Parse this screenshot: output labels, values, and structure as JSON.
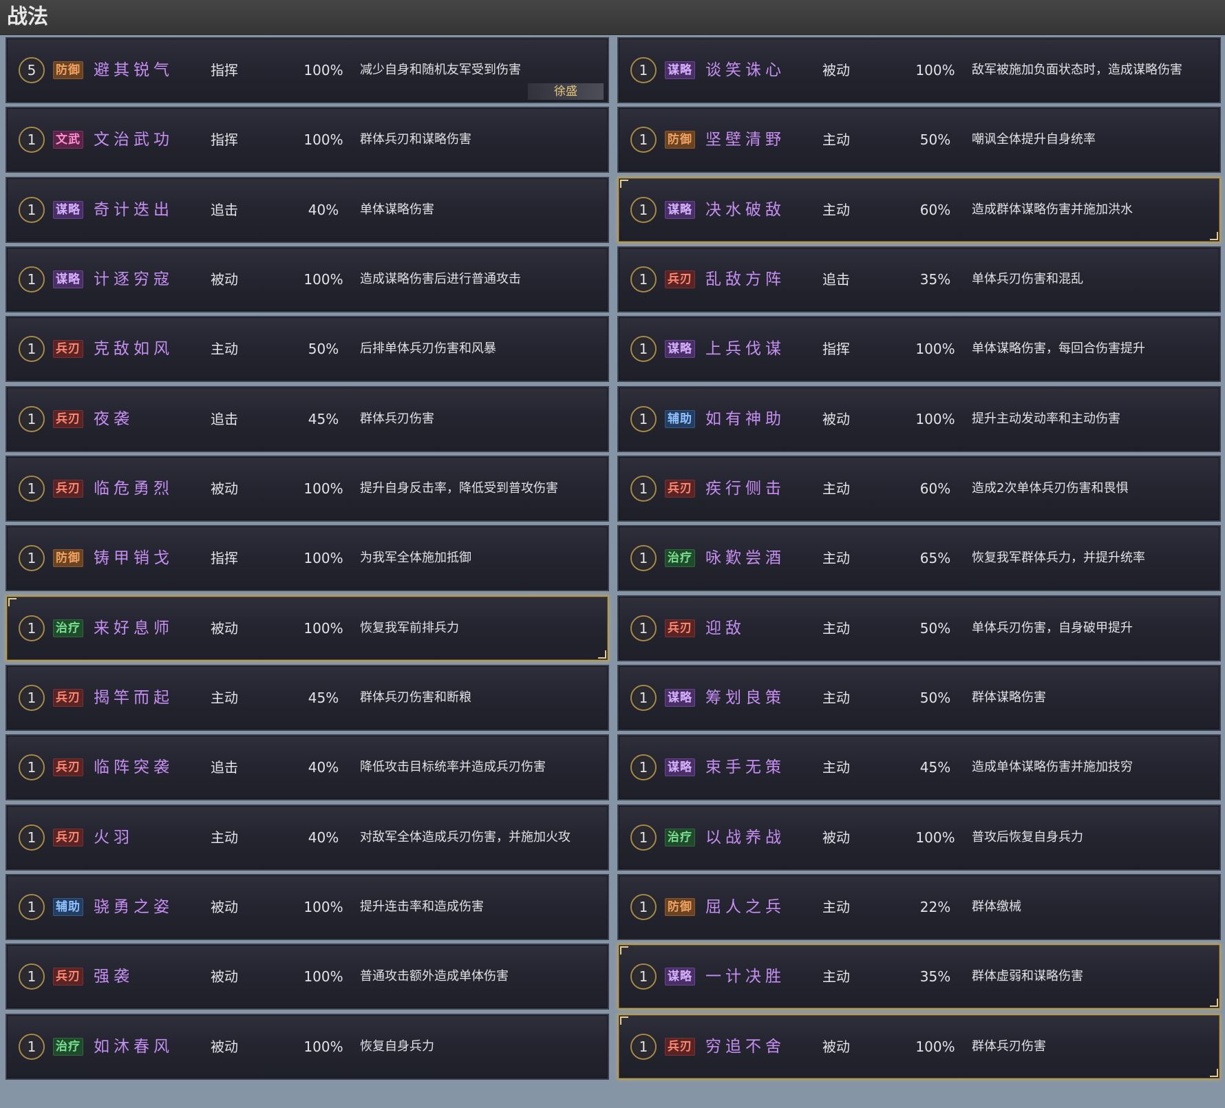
{
  "window": {
    "title": "战法"
  },
  "columns": [
    {
      "cards": [
        {
          "level": "5",
          "tag": "防御",
          "name": "避其锐气",
          "type": "指挥",
          "rate": "100%",
          "desc": "减少自身和随机友军受到伤害",
          "hero": "徐盛",
          "highlighted": false
        },
        {
          "level": "1",
          "tag": "文武",
          "name": "文治武功",
          "type": "指挥",
          "rate": "100%",
          "desc": "群体兵刃和谋略伤害",
          "highlighted": false
        },
        {
          "level": "1",
          "tag": "谋略",
          "name": "奇计迭出",
          "type": "追击",
          "rate": "40%",
          "desc": "单体谋略伤害",
          "highlighted": false
        },
        {
          "level": "1",
          "tag": "谋略",
          "name": "计逐穷寇",
          "type": "被动",
          "rate": "100%",
          "desc": "造成谋略伤害后进行普通攻击",
          "highlighted": false
        },
        {
          "level": "1",
          "tag": "兵刃",
          "name": "克敌如风",
          "type": "主动",
          "rate": "50%",
          "desc": "后排单体兵刃伤害和风暴",
          "highlighted": false
        },
        {
          "level": "1",
          "tag": "兵刃",
          "name": "夜袭",
          "type": "追击",
          "rate": "45%",
          "desc": "群体兵刃伤害",
          "highlighted": false
        },
        {
          "level": "1",
          "tag": "兵刃",
          "name": "临危勇烈",
          "type": "被动",
          "rate": "100%",
          "desc": "提升自身反击率，降低受到普攻伤害",
          "highlighted": false
        },
        {
          "level": "1",
          "tag": "防御",
          "name": "铸甲销戈",
          "type": "指挥",
          "rate": "100%",
          "desc": "为我军全体施加抵御",
          "highlighted": false
        },
        {
          "level": "1",
          "tag": "治疗",
          "name": "来好息师",
          "type": "被动",
          "rate": "100%",
          "desc": "恢复我军前排兵力",
          "highlighted": true
        },
        {
          "level": "1",
          "tag": "兵刃",
          "name": "揭竿而起",
          "type": "主动",
          "rate": "45%",
          "desc": "群体兵刃伤害和断粮",
          "highlighted": false
        },
        {
          "level": "1",
          "tag": "兵刃",
          "name": "临阵突袭",
          "type": "追击",
          "rate": "40%",
          "desc": "降低攻击目标统率并造成兵刃伤害",
          "highlighted": false
        },
        {
          "level": "1",
          "tag": "兵刃",
          "name": "火羽",
          "type": "主动",
          "rate": "40%",
          "desc": "对敌军全体造成兵刃伤害，并施加火攻",
          "highlighted": false
        },
        {
          "level": "1",
          "tag": "辅助",
          "name": "骁勇之姿",
          "type": "被动",
          "rate": "100%",
          "desc": "提升连击率和造成伤害",
          "highlighted": false
        },
        {
          "level": "1",
          "tag": "兵刃",
          "name": "强袭",
          "type": "被动",
          "rate": "100%",
          "desc": "普通攻击额外造成单体伤害",
          "highlighted": false
        },
        {
          "level": "1",
          "tag": "治疗",
          "name": "如沐春风",
          "type": "被动",
          "rate": "100%",
          "desc": "恢复自身兵力",
          "highlighted": false
        }
      ]
    },
    {
      "cards": [
        {
          "level": "1",
          "tag": "谋略",
          "name": "谈笑诛心",
          "type": "被动",
          "rate": "100%",
          "desc": "敌军被施加负面状态时，造成谋略伤害",
          "highlighted": false
        },
        {
          "level": "1",
          "tag": "防御",
          "name": "坚壁清野",
          "type": "主动",
          "rate": "50%",
          "desc": "嘲讽全体提升自身统率",
          "highlighted": false
        },
        {
          "level": "1",
          "tag": "谋略",
          "name": "决水破敌",
          "type": "主动",
          "rate": "60%",
          "desc": "造成群体谋略伤害并施加洪水",
          "highlighted": true
        },
        {
          "level": "1",
          "tag": "兵刃",
          "name": "乱敌方阵",
          "type": "追击",
          "rate": "35%",
          "desc": "单体兵刃伤害和混乱",
          "highlighted": false
        },
        {
          "level": "1",
          "tag": "谋略",
          "name": "上兵伐谋",
          "type": "指挥",
          "rate": "100%",
          "desc": "单体谋略伤害，每回合伤害提升",
          "highlighted": false
        },
        {
          "level": "1",
          "tag": "辅助",
          "name": "如有神助",
          "type": "被动",
          "rate": "100%",
          "desc": "提升主动发动率和主动伤害",
          "highlighted": false
        },
        {
          "level": "1",
          "tag": "兵刃",
          "name": "疾行侧击",
          "type": "主动",
          "rate": "60%",
          "desc": "造成2次单体兵刃伤害和畏惧",
          "highlighted": false
        },
        {
          "level": "1",
          "tag": "治疗",
          "name": "咏歎尝酒",
          "type": "主动",
          "rate": "65%",
          "desc": "恢复我军群体兵力，并提升统率",
          "highlighted": false
        },
        {
          "level": "1",
          "tag": "兵刃",
          "name": "迎敌",
          "type": "主动",
          "rate": "50%",
          "desc": "单体兵刃伤害，自身破甲提升",
          "highlighted": false
        },
        {
          "level": "1",
          "tag": "谋略",
          "name": "筹划良策",
          "type": "主动",
          "rate": "50%",
          "desc": "群体谋略伤害",
          "highlighted": false
        },
        {
          "level": "1",
          "tag": "谋略",
          "name": "束手无策",
          "type": "主动",
          "rate": "45%",
          "desc": "造成单体谋略伤害并施加技穷",
          "highlighted": false
        },
        {
          "level": "1",
          "tag": "治疗",
          "name": "以战养战",
          "type": "被动",
          "rate": "100%",
          "desc": "普攻后恢复自身兵力",
          "highlighted": false
        },
        {
          "level": "1",
          "tag": "防御",
          "name": "屈人之兵",
          "type": "主动",
          "rate": "22%",
          "desc": "群体缴械",
          "highlighted": false
        },
        {
          "level": "1",
          "tag": "谋略",
          "name": "一计决胜",
          "type": "主动",
          "rate": "35%",
          "desc": "群体虚弱和谋略伤害",
          "highlighted": true
        },
        {
          "level": "1",
          "tag": "兵刃",
          "name": "穷追不舍",
          "type": "被动",
          "rate": "100%",
          "desc": "群体兵刃伤害",
          "highlighted": true
        }
      ]
    }
  ]
}
